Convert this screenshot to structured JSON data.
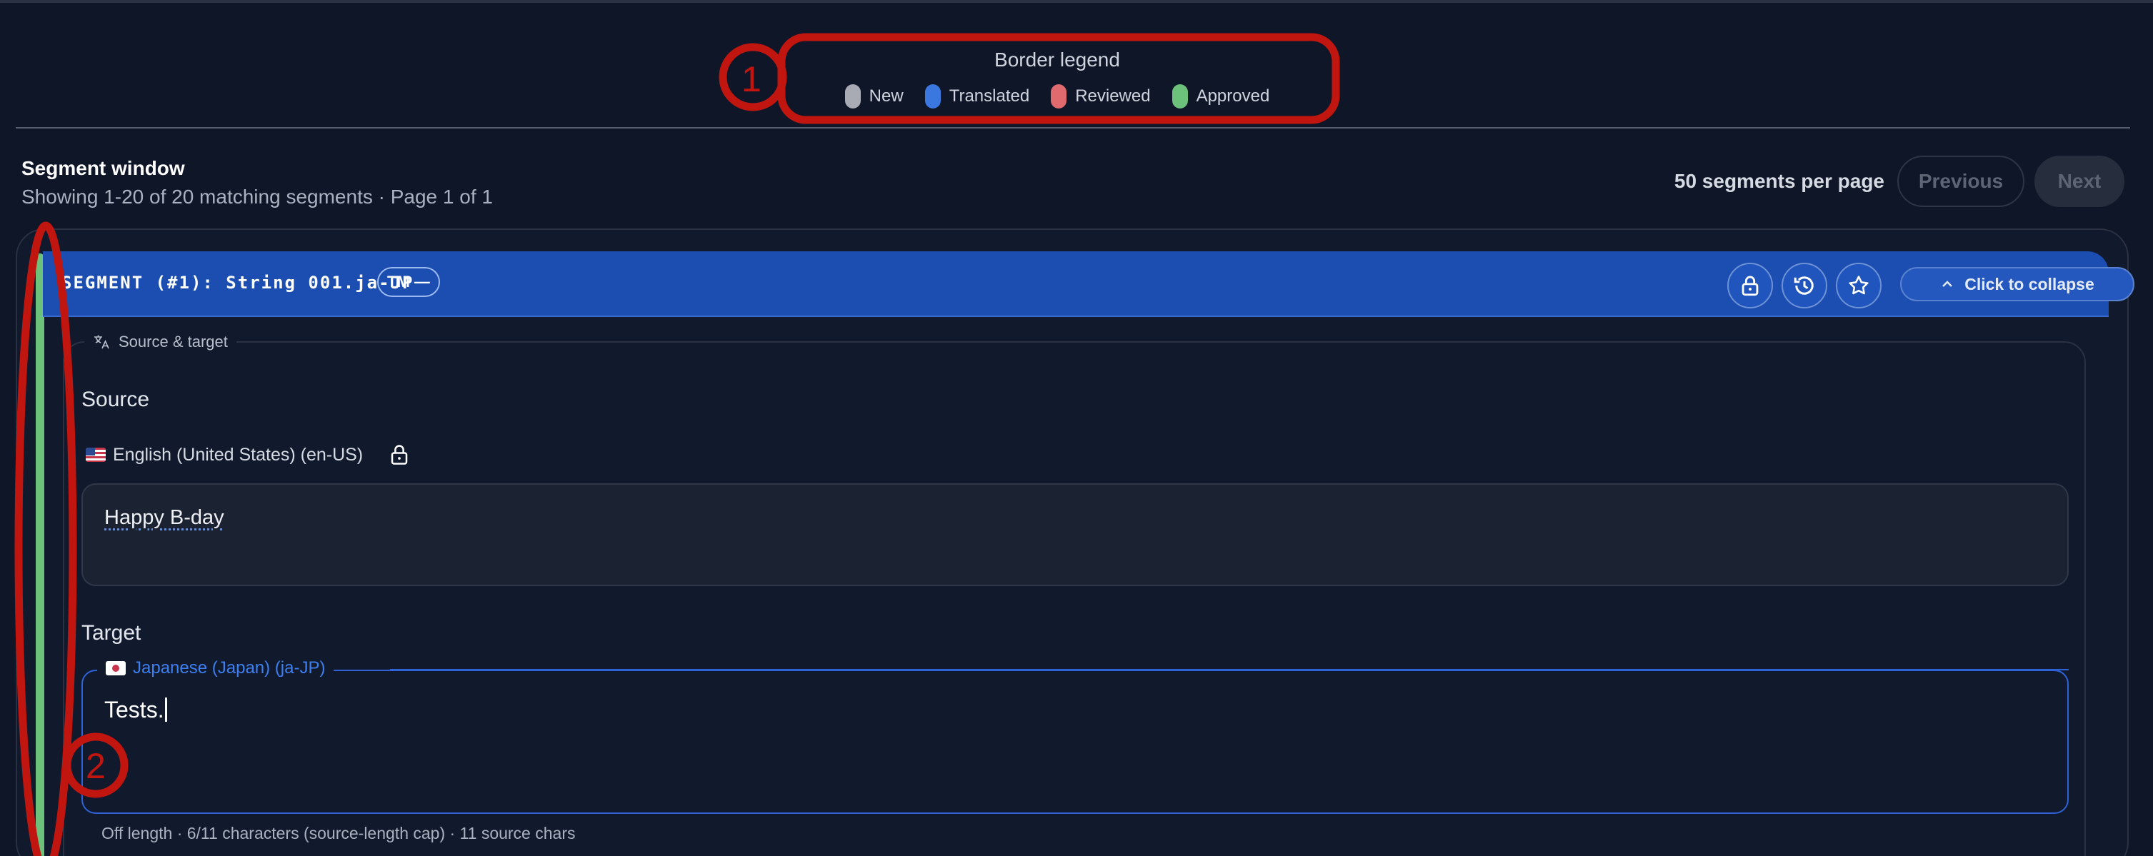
{
  "legend": {
    "title": "Border legend",
    "items": [
      {
        "label": "New",
        "color": "#a8abb3"
      },
      {
        "label": "Translated",
        "color": "#3a78e0"
      },
      {
        "label": "Reviewed",
        "color": "#e06a6e"
      },
      {
        "label": "Approved",
        "color": "#6cc27a"
      }
    ]
  },
  "segment_window": {
    "title": "Segment window",
    "subtitle": "Showing 1-20 of 20 matching segments · Page 1 of 1",
    "per_page_label": "50 segments per page",
    "previous_label": "Previous",
    "next_label": "Next"
  },
  "segment": {
    "header_title": "SEGMENT (#1): String 001.ja-JP",
    "tm_badge": "TM —",
    "collapse_label": "Click to collapse",
    "status_color": "#6cc27a",
    "fieldset_label": "Source & target",
    "source_heading": "Source",
    "source_language": "English (United States) (en-US)",
    "source_text": "Happy B-day",
    "target_heading": "Target",
    "target_language": "Japanese (Japan) (ja-JP)",
    "target_text": "Tests.",
    "length_info": "Off length · 6/11 characters (source-length cap) · 11 source chars"
  },
  "annotations": [
    "1",
    "2"
  ],
  "colors": {
    "background": "#0f1628",
    "header_blue": "#1b4eb0",
    "annotation_red": "#c0160f",
    "target_border": "#2d63d6"
  }
}
